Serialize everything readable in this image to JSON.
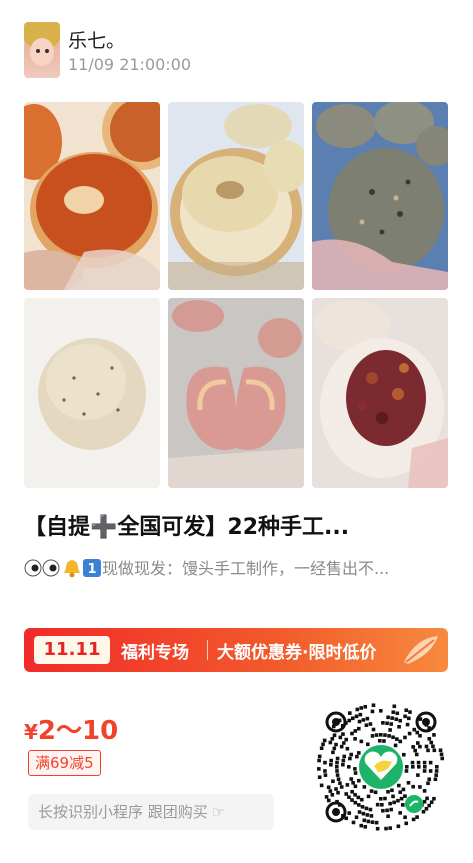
{
  "post": {
    "author": "乐七。",
    "timestamp": "11/09 21:00:00",
    "title": "【自提➕全国可发】22种手工...",
    "description": "现做现发：馒头手工制作，一经售出不...",
    "description_emojis": [
      "eyes-icon",
      "eyes-icon",
      "bell-icon",
      "keycap-1-icon"
    ]
  },
  "photos": [
    {
      "name": "photo-bagel-tomato",
      "icon": "bread-icon"
    },
    {
      "name": "photo-bagel-steamer",
      "icon": "bread-icon"
    },
    {
      "name": "photo-multigrain-bun",
      "icon": "bread-icon"
    },
    {
      "name": "photo-plain-bun",
      "icon": "bread-icon"
    },
    {
      "name": "photo-butterfly-pastry",
      "icon": "bread-icon"
    },
    {
      "name": "photo-raisin-bun",
      "icon": "bread-icon"
    }
  ],
  "banner": {
    "badge": "11.11",
    "label": "福利专场",
    "promo": "大额优惠券·限时低价",
    "colors": {
      "start": "#f12a2a",
      "end": "#f78a3e"
    }
  },
  "price": {
    "currency": "¥",
    "range": "2～10",
    "color": "#f0432d"
  },
  "discount": "满69减5",
  "mini_program_hint": "长按识别小程序 跟团购买",
  "qr_icon": "mini-program-qr-code"
}
